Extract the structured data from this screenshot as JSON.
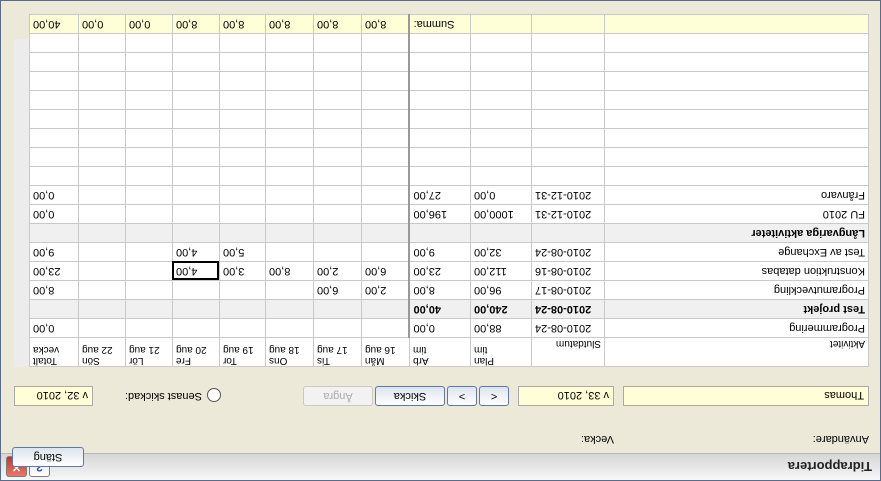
{
  "window": {
    "title": "Tidrapportera",
    "help_label": "?",
    "close_label": "✕"
  },
  "form": {
    "user_label": "Användare:",
    "user_value": "Thomas",
    "week_label": "Vecka:",
    "week_value": "v 33, 2010",
    "prev_label": "<",
    "next_label": ">",
    "send_label": "Skicka",
    "undo_label": "Ångra",
    "last_sent_label": "Senast skickad:",
    "last_sent_value": "v 32, 2010"
  },
  "close_button_label": "Stäng",
  "table": {
    "headers": {
      "activity": "Aktivitet",
      "enddate": "Slutdatum",
      "plan": [
        "Plan",
        "tim"
      ],
      "arb": [
        "Arb",
        "tim"
      ],
      "days": [
        [
          "Mån",
          "16 aug"
        ],
        [
          "Tis",
          "17 aug"
        ],
        [
          "Ons",
          "18 aug"
        ],
        [
          "Tor",
          "19 aug"
        ],
        [
          "Fre",
          "20 aug"
        ],
        [
          "Lör",
          "21 aug"
        ],
        [
          "Sön",
          "22 aug"
        ]
      ],
      "total": [
        "Totalt",
        "vecka"
      ]
    },
    "rows": [
      {
        "type": "item",
        "activity": "Programmering",
        "enddate": "2010-08-24",
        "plan": "88,00",
        "arb": "0,00",
        "days": [
          "",
          "",
          "",
          "",
          "",
          "",
          ""
        ],
        "total": "0,00"
      },
      {
        "type": "group",
        "activity": "Test projekt",
        "enddate": "2010-08-24",
        "plan": "240,00",
        "arb": "40,00"
      },
      {
        "type": "item",
        "activity": "Programutveckling",
        "enddate": "2010-08-17",
        "plan": "96,00",
        "arb": "8,00",
        "days": [
          "2,00",
          "6,00",
          "",
          "",
          "",
          "",
          ""
        ],
        "total": "8,00"
      },
      {
        "type": "item",
        "activity": "Konstruktion databas",
        "enddate": "2010-08-16",
        "plan": "112,00",
        "arb": "23,00",
        "days": [
          "6,00",
          "2,00",
          "8,00",
          "3,00",
          "4,00",
          "",
          ""
        ],
        "total": "23,00",
        "selected_day": 4
      },
      {
        "type": "item",
        "activity": "Test av Exchange",
        "enddate": "2010-08-24",
        "plan": "32,00",
        "arb": "9,00",
        "days": [
          "",
          "",
          "",
          "5,00",
          "4,00",
          "",
          ""
        ],
        "total": "9,00"
      },
      {
        "type": "group",
        "activity": "Långvariga aktiviteter",
        "enddate": "",
        "plan": "",
        "arb": ""
      },
      {
        "type": "item",
        "activity": "FU 2010",
        "enddate": "2010-12-31",
        "plan": "1000,00",
        "arb": "196,00",
        "days": [
          "",
          "",
          "",
          "",
          "",
          "",
          ""
        ],
        "total": "0,00"
      },
      {
        "type": "item",
        "activity": "Frånvaro",
        "enddate": "2010-12-31",
        "plan": "0,00",
        "arb": "27,00",
        "days": [
          "",
          "",
          "",
          "",
          "",
          "",
          ""
        ],
        "total": "0,00"
      }
    ],
    "empty_rows": 8,
    "sum": {
      "label": "Summa:",
      "days": [
        "8,00",
        "8,00",
        "8,00",
        "8,00",
        "8,00",
        "0,00",
        "0,00"
      ],
      "total": "40,00"
    }
  }
}
